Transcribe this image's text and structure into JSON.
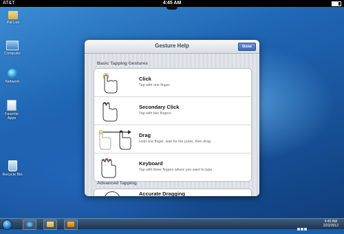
{
  "status_bar": {
    "carrier": "AT&T",
    "time": "4:45 AM"
  },
  "desktop_icons": [
    {
      "label": "Pat Lee",
      "icon": "folder-icon"
    },
    {
      "label": "Computer",
      "icon": "computer-icon"
    },
    {
      "label": "Network",
      "icon": "network-icon"
    },
    {
      "label": "Favorite Apps",
      "icon": "favorite-apps-icon"
    },
    {
      "label": "Recycle Bin",
      "icon": "recycle-bin-icon"
    }
  ],
  "taskbar": {
    "clock_time": "4:45 AM",
    "clock_date": "2/22/2012"
  },
  "dialog": {
    "title": "Gesture Help",
    "done_label": "Done",
    "sections": [
      {
        "header": "Basic Tapping Gestures",
        "items": [
          {
            "title": "Click",
            "subtitle": "Tap with one finger.",
            "icon": "one-finger-tap-icon"
          },
          {
            "title": "Secondary Click",
            "subtitle": "Tap with two fingers.",
            "icon": "two-finger-tap-icon"
          },
          {
            "title": "Drag",
            "subtitle": "Hold one finger, wait for the pulse, then drag.",
            "icon": "drag-gesture-icon"
          },
          {
            "title": "Keyboard",
            "subtitle": "Tap with three fingers where you want to type.",
            "icon": "three-finger-tap-icon"
          }
        ]
      },
      {
        "header": "Advanced Tapping",
        "items": [
          {
            "title": "Accurate Dragging",
            "icon": "accurate-drag-icon"
          }
        ]
      }
    ]
  },
  "colors": {
    "accent": "#3a68b9",
    "desktop": "#1f66b4"
  }
}
